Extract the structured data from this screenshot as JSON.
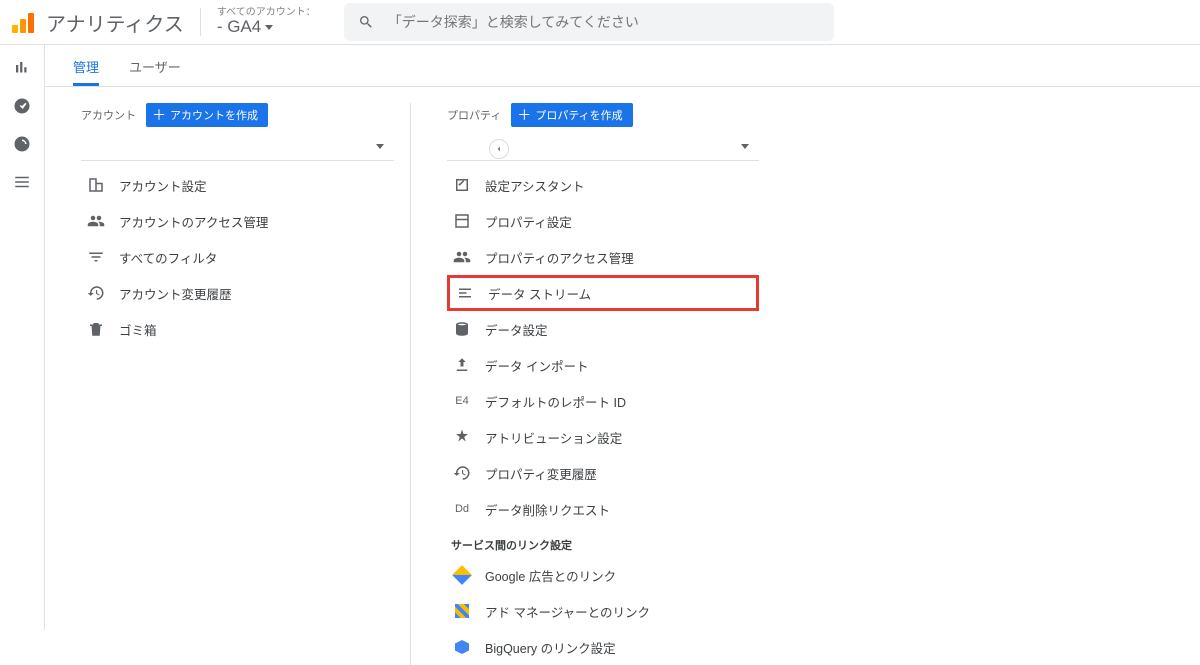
{
  "header": {
    "app_title": "アナリティクス",
    "accounts_label": "すべてのアカウント：",
    "account_value": "- GA4",
    "search_placeholder": "「データ探索」と検索してみてください"
  },
  "tabs": {
    "admin": "管理",
    "user": "ユーザー"
  },
  "account_col": {
    "title": "アカウント",
    "create_btn": "アカウントを作成",
    "items": {
      "settings": "アカウント設定",
      "access": "アカウントのアクセス管理",
      "filters": "すべてのフィルタ",
      "history": "アカウント変更履歴",
      "trash": "ゴミ箱"
    }
  },
  "property_col": {
    "title": "プロパティ",
    "create_btn": "プロパティを作成",
    "items": {
      "assistant": "設定アシスタント",
      "settings": "プロパティ設定",
      "access": "プロパティのアクセス管理",
      "streams": "データ ストリーム",
      "data_settings": "データ設定",
      "import": "データ インポート",
      "report_id": "デフォルトのレポート ID",
      "attribution": "アトリビューション設定",
      "history": "プロパティ変更履歴",
      "delete_req": "データ削除リクエスト",
      "section_links": "サービス間のリンク設定",
      "google_ads": "Google 広告とのリンク",
      "ad_manager": "アド マネージャーとのリンク",
      "bigquery": "BigQuery のリンク設定"
    },
    "report_id_badge": "E4",
    "delete_badge": "Dd"
  }
}
